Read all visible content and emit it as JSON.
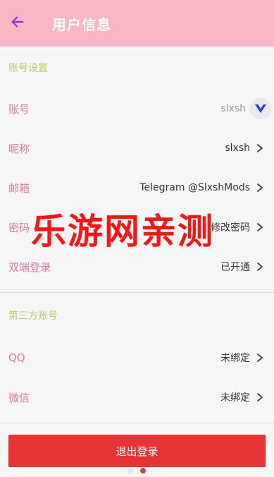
{
  "appbar": {
    "title": "用户信息",
    "back_icon": "arrow-left-icon",
    "bg_color": "#f9b6c3",
    "back_color": "#8b3bd9"
  },
  "sections": {
    "account": {
      "header": "账号设置"
    },
    "third_party": {
      "header": "第三方账号"
    }
  },
  "rows": {
    "account_id": {
      "label": "账号",
      "value": "slxsh"
    },
    "nickname": {
      "label": "昵称",
      "value": "slxsh"
    },
    "email": {
      "label": "邮箱",
      "value": "Telegram @SlxshMods"
    },
    "password": {
      "label": "密码",
      "value": "点击修改密码"
    },
    "dual": {
      "label": "双端登录",
      "value": "已开通"
    },
    "qq": {
      "label": "QQ",
      "value": "未绑定"
    },
    "wechat": {
      "label": "微信",
      "value": "未绑定"
    }
  },
  "watermark": {
    "text": "乐游网亲测"
  },
  "logout": {
    "label": "退出登录",
    "color": "#e73535"
  },
  "colors": {
    "label": "#e27a9d",
    "section_header": "#b8cf6a",
    "value": "#333333"
  }
}
